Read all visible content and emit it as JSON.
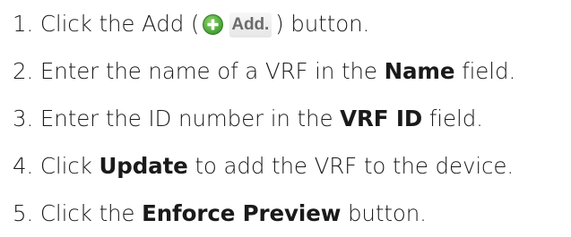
{
  "steps": [
    {
      "number": "1.",
      "before": "Click the Add (",
      "button_label": "Add.",
      "after": ") button."
    },
    {
      "number": "2.",
      "before": "Enter the name of a VRF in the ",
      "bold": "Name",
      "after": " field."
    },
    {
      "number": "3.",
      "before": "Enter the ID number in the ",
      "bold": "VRF ID",
      "after": " field."
    },
    {
      "number": "4.",
      "before": "Click ",
      "bold": "Update",
      "after": " to add the VRF to the device."
    },
    {
      "number": "5.",
      "before": "Click the ",
      "bold": "Enforce Preview",
      "after": " button."
    }
  ],
  "icons": {
    "add_icon": "plus-circle-icon",
    "add_icon_color": "#4caf3a"
  },
  "colors": {
    "text": "#1a1a1a",
    "button_text": "#6b6b6b"
  }
}
